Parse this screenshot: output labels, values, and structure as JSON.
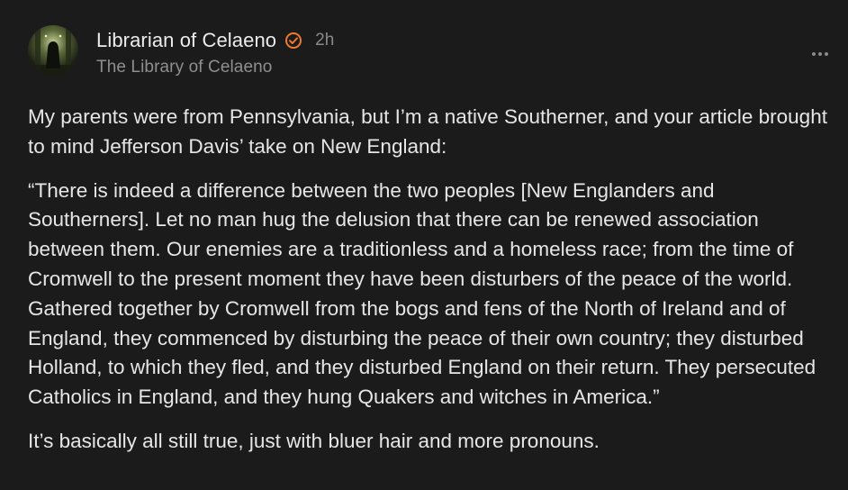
{
  "comment": {
    "author": {
      "name": "Librarian of Celaeno",
      "publication": "The Library of Celaeno",
      "avatar_icon": "hooded-figure-in-corridor",
      "verified_icon": "verified-check-icon",
      "verified_color": "#f07a2b"
    },
    "timestamp": "2h",
    "more_icon": "ellipsis-icon",
    "paragraphs": [
      "My parents were from Pennsylvania, but I’m a native Southerner, and your article brought to mind Jefferson Davis’ take on New England:",
      "“There is indeed a difference between the two peoples [New Englanders and Southerners]. Let no man hug the delusion that there can be renewed association between them. Our enemies are a traditionless and a homeless race; from the time of Cromwell to the present moment they have been disturbers of the peace of the world. Gathered together by Cromwell from the bogs and fens of the North of Ireland and of England, they commenced by disturbing the peace of their own country; they disturbed Holland, to which they fled, and they disturbed England on their return. They persecuted Catholics in England, and they hung Quakers and witches in America.”",
      "It’s basically all still true, just with bluer hair and more pronouns."
    ]
  }
}
